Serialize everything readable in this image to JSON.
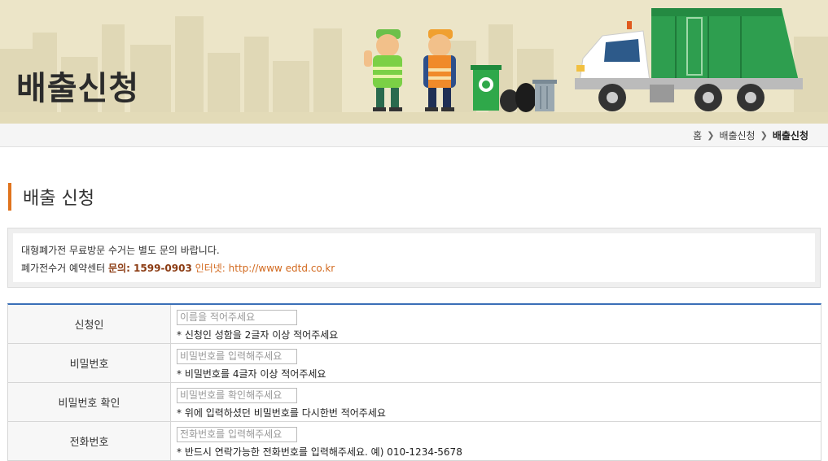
{
  "banner": {
    "title": "배출신청"
  },
  "breadcrumb": {
    "home": "홈",
    "parent": "배출신청",
    "current": "배출신청"
  },
  "section": {
    "title": "배출 신청"
  },
  "notice": {
    "line1": "대형폐가전 무료방문 수거는 별도 문의 바랍니다.",
    "line2_prefix": "폐가전수거 예약센터 ",
    "line2_phone": "문의: 1599-0903",
    "line2_web_label": "인터넷: ",
    "line2_web": "http://www edtd.co.kr"
  },
  "form": {
    "rows": [
      {
        "label": "신청인",
        "placeholder": "이름을 적어주세요",
        "hint": "* 신청인 성함을 2글자 이상 적어주세요"
      },
      {
        "label": "비밀번호",
        "placeholder": "비밀번호를 입력해주세요",
        "hint": "* 비밀번호를 4글자 이상 적어주세요"
      },
      {
        "label": "비밀번호 확인",
        "placeholder": "비밀번호를 확인해주세요",
        "hint": "* 위에 입력하셨던 비밀번호를 다시한번 적어주세요"
      },
      {
        "label": "전화번호",
        "placeholder": "전화번호를 입력해주세요",
        "hint": "* 반드시 연락가능한 전화번호를 입력해주세요. 예) 010-1234-5678"
      }
    ]
  },
  "colors": {
    "banner_bg": "#ece5c8",
    "accent_orange": "#e0741e",
    "table_top_border": "#3a6fb7",
    "truck_green": "#2e9e4f"
  }
}
